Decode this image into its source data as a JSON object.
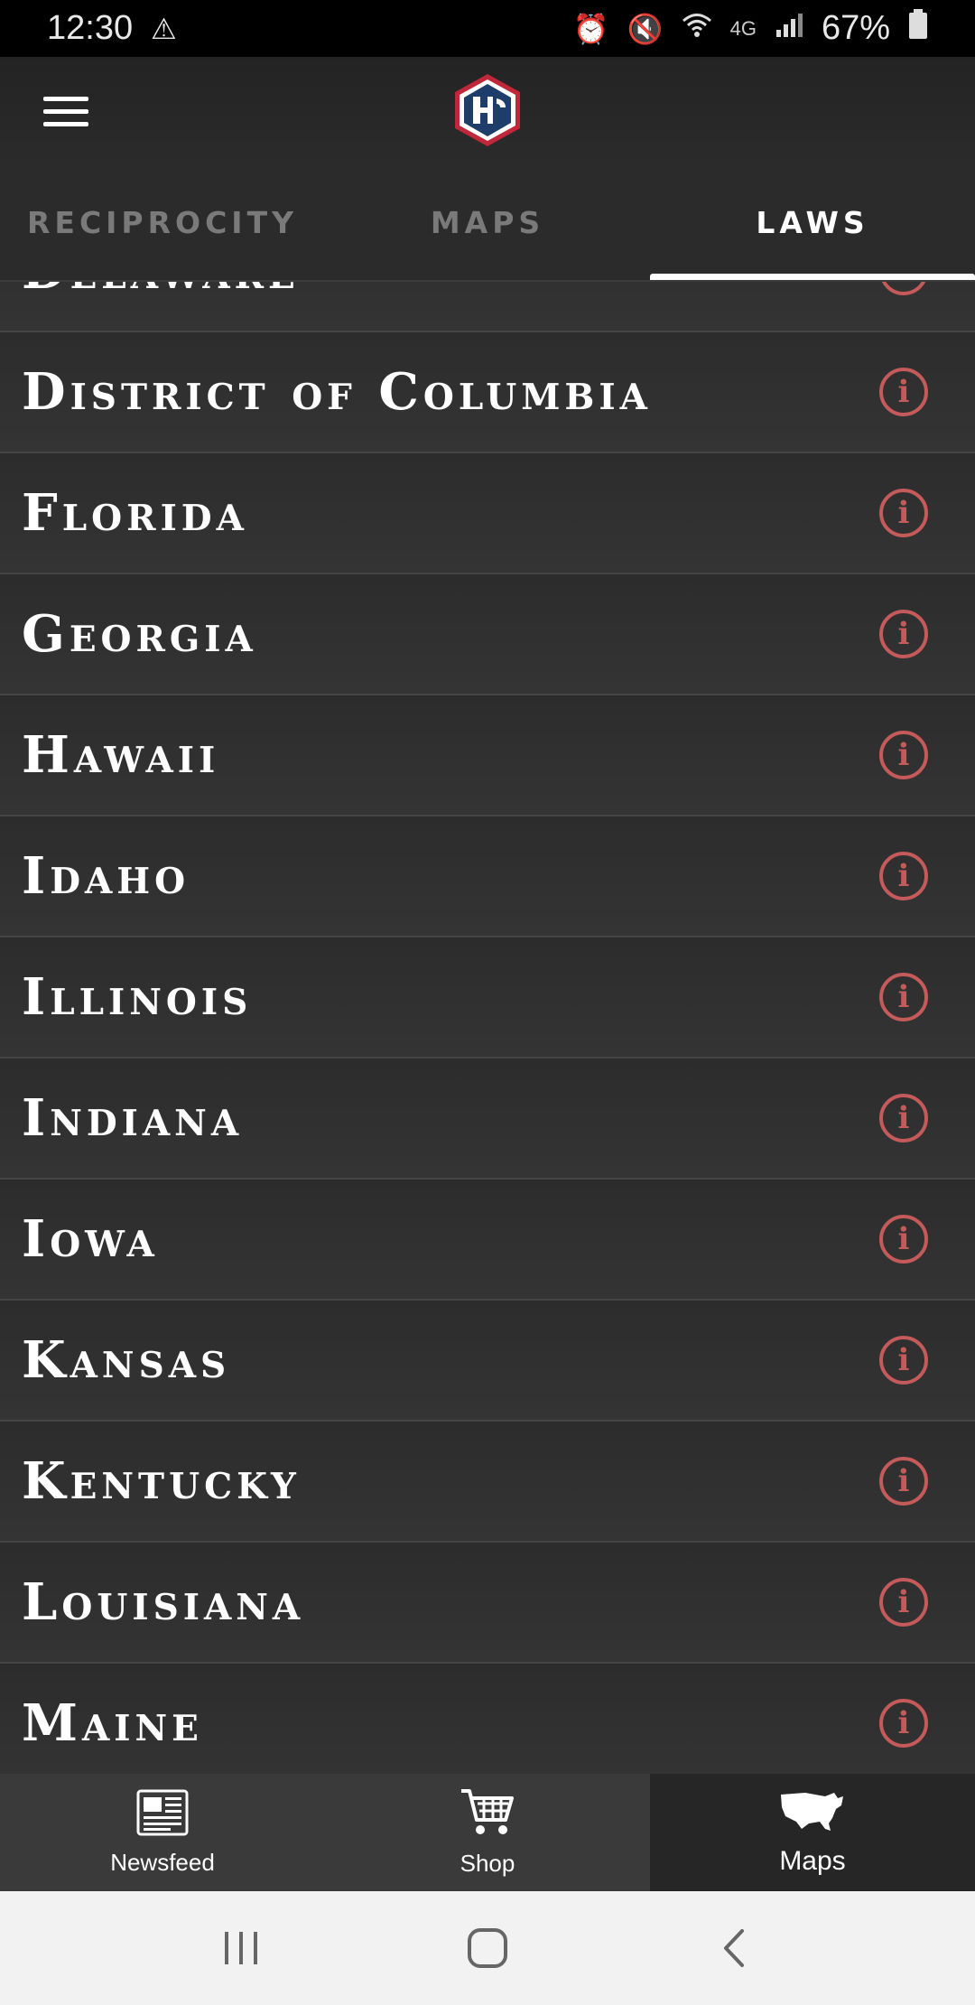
{
  "status": {
    "time": "12:30",
    "network": "4G",
    "battery": "67%"
  },
  "tabs": [
    {
      "label": "RECIPROCITY",
      "active": false
    },
    {
      "label": "MAPS",
      "active": false
    },
    {
      "label": "LAWS",
      "active": true
    }
  ],
  "states": [
    "Delaware",
    "District of Columbia",
    "Florida",
    "Georgia",
    "Hawaii",
    "Idaho",
    "Illinois",
    "Indiana",
    "Iowa",
    "Kansas",
    "Kentucky",
    "Louisiana",
    "Maine"
  ],
  "info_icon": "info-icon",
  "bottom_nav": [
    {
      "label": "Newsfeed",
      "icon": "newspaper-icon"
    },
    {
      "label": "Shop",
      "icon": "cart-icon"
    },
    {
      "label": "Maps",
      "icon": "usa-map-icon",
      "active": true
    }
  ],
  "colors": {
    "accent": "#c45a5a",
    "background": "#2a2a2a",
    "logo_blue": "#1f3d6b",
    "logo_red": "#c0273a"
  }
}
